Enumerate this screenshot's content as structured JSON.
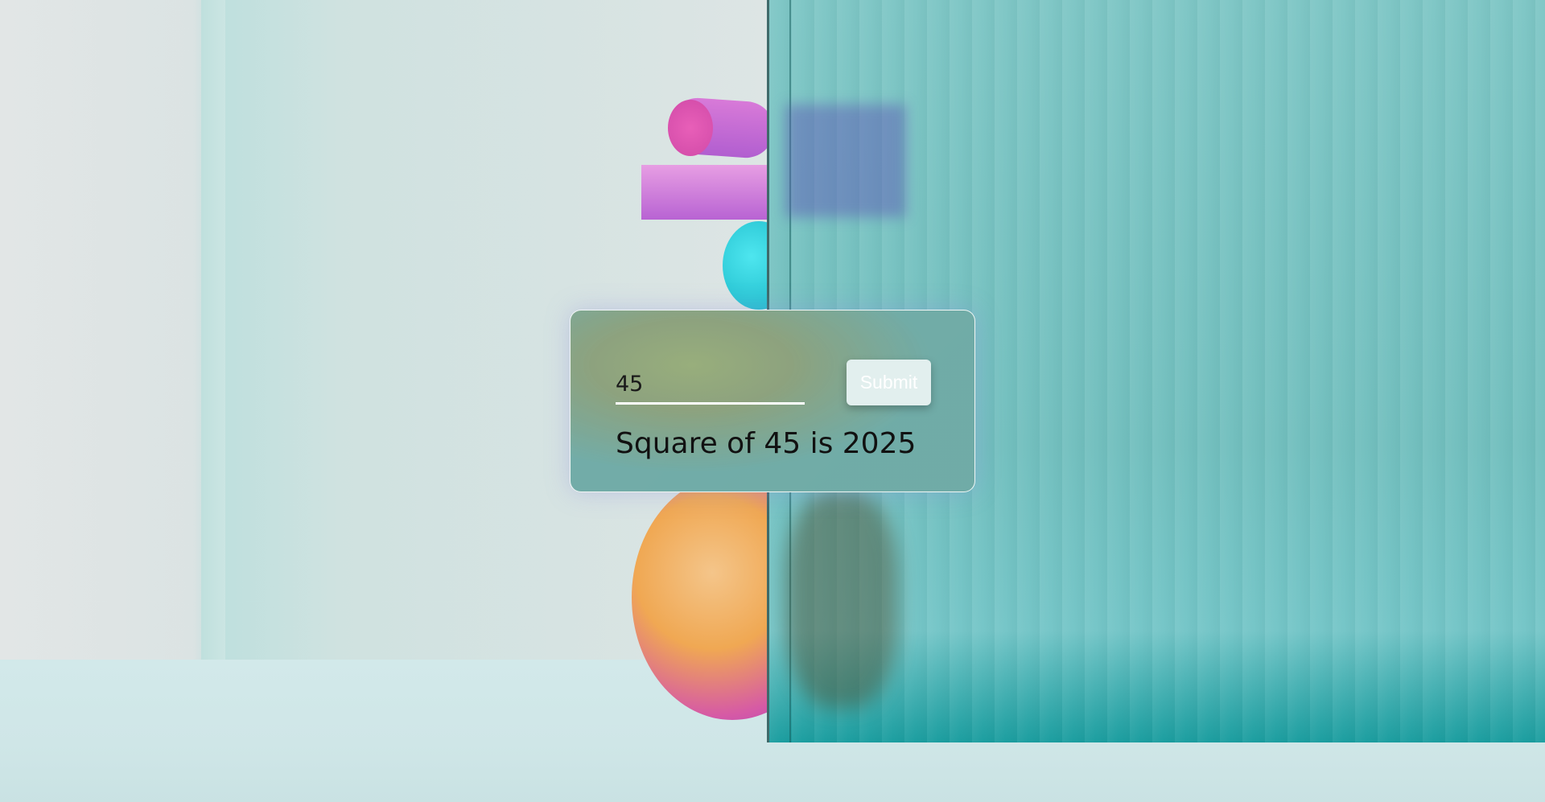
{
  "form": {
    "input_value": "45",
    "submit_label": "Submit"
  },
  "result": {
    "text": "Square of 45 is 2025"
  }
}
